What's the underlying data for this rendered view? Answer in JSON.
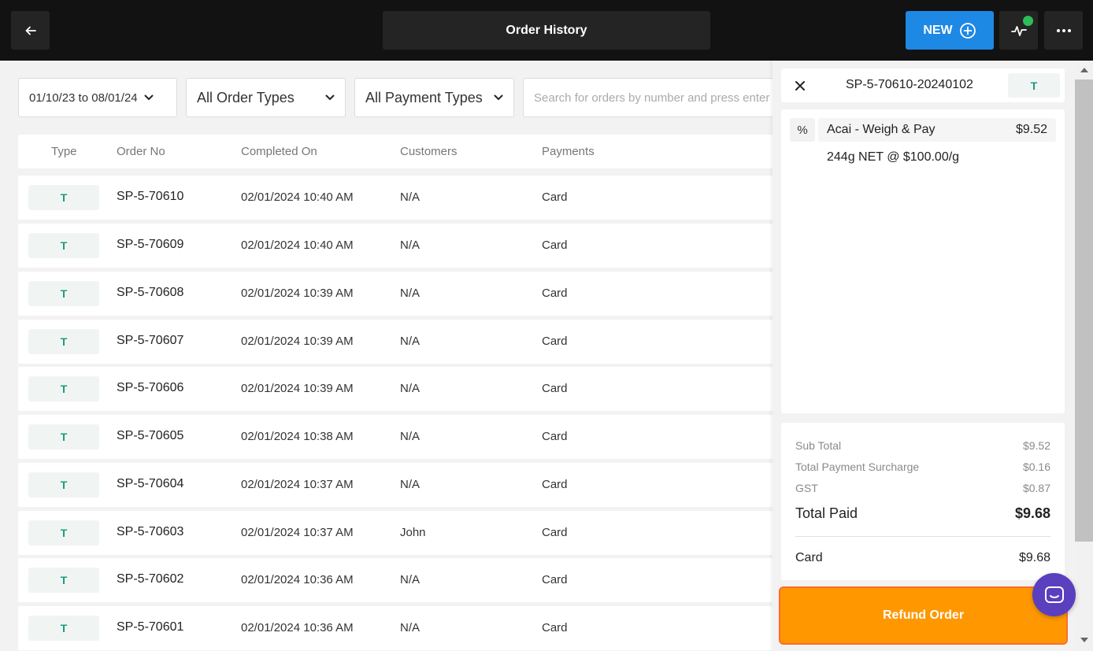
{
  "header": {
    "title": "Order History",
    "new_label": "NEW"
  },
  "filters": {
    "date_range": "01/10/23 to 08/01/24",
    "order_type": "All Order Types",
    "payment_type": "All Payment Types",
    "search_placeholder": "Search for orders by number and press enter"
  },
  "table": {
    "columns": [
      "Type",
      "Order No",
      "Completed On",
      "Customers",
      "Payments"
    ],
    "rows": [
      {
        "type": "T",
        "order_no": "SP-5-70610",
        "completed_on": "02/01/2024 10:40 AM",
        "customer": "N/A",
        "payment": "Card"
      },
      {
        "type": "T",
        "order_no": "SP-5-70609",
        "completed_on": "02/01/2024 10:40 AM",
        "customer": "N/A",
        "payment": "Card"
      },
      {
        "type": "T",
        "order_no": "SP-5-70608",
        "completed_on": "02/01/2024 10:39 AM",
        "customer": "N/A",
        "payment": "Card"
      },
      {
        "type": "T",
        "order_no": "SP-5-70607",
        "completed_on": "02/01/2024 10:39 AM",
        "customer": "N/A",
        "payment": "Card"
      },
      {
        "type": "T",
        "order_no": "SP-5-70606",
        "completed_on": "02/01/2024 10:39 AM",
        "customer": "N/A",
        "payment": "Card"
      },
      {
        "type": "T",
        "order_no": "SP-5-70605",
        "completed_on": "02/01/2024 10:38 AM",
        "customer": "N/A",
        "payment": "Card"
      },
      {
        "type": "T",
        "order_no": "SP-5-70604",
        "completed_on": "02/01/2024 10:37 AM",
        "customer": "N/A",
        "payment": "Card"
      },
      {
        "type": "T",
        "order_no": "SP-5-70603",
        "completed_on": "02/01/2024 10:37 AM",
        "customer": "John",
        "payment": "Card"
      },
      {
        "type": "T",
        "order_no": "SP-5-70602",
        "completed_on": "02/01/2024 10:36 AM",
        "customer": "N/A",
        "payment": "Card"
      },
      {
        "type": "T",
        "order_no": "SP-5-70601",
        "completed_on": "02/01/2024 10:36 AM",
        "customer": "N/A",
        "payment": "Card"
      }
    ]
  },
  "panel": {
    "order_no": "SP-5-70610-20240102",
    "type": "T",
    "discount_symbol": "%",
    "item_name": "Acai - Weigh & Pay",
    "item_price": "$9.52",
    "item_detail": "244g NET @ $100.00/g",
    "sub_total_label": "Sub Total",
    "sub_total_value": "$9.52",
    "surcharge_label": "Total Payment Surcharge",
    "surcharge_value": "$0.16",
    "gst_label": "GST",
    "gst_value": "$0.87",
    "total_paid_label": "Total Paid",
    "total_paid_value": "$9.68",
    "payment_label": "Card",
    "payment_value": "$9.68",
    "refund_label": "Refund Order"
  },
  "colors": {
    "topbar": "#121212",
    "accent_blue": "#1e88e5",
    "refund_orange": "#ff9800",
    "type_green": "#1a9c84",
    "status_green": "#2ebd59",
    "chat_purple": "#5a3fbf"
  }
}
